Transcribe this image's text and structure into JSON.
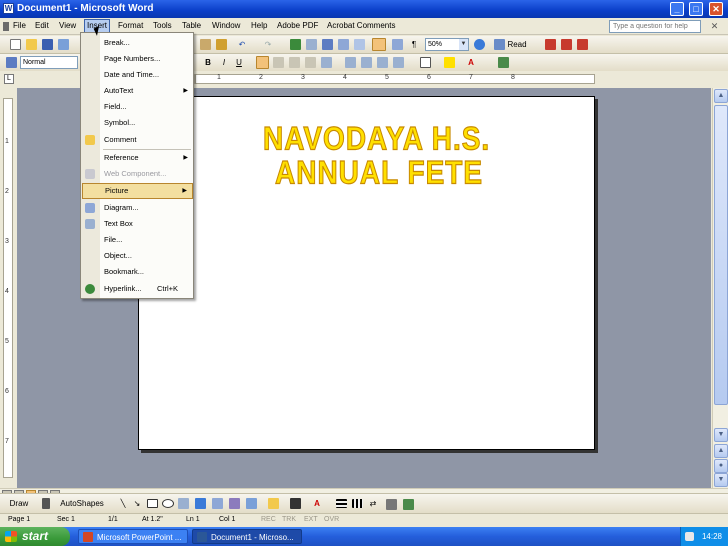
{
  "window": {
    "title": "Document1 - Microsoft Word",
    "minimize_glyph": "_",
    "maximize_glyph": "□",
    "close_glyph": "✕",
    "doc_close_glyph": "✕"
  },
  "menubar": {
    "items": [
      "File",
      "Edit",
      "View",
      "Insert",
      "Format",
      "Tools",
      "Table",
      "Window",
      "Help",
      "Adobe PDF",
      "Acrobat Comments"
    ],
    "active": "Insert",
    "help_placeholder": "Type a question for help"
  },
  "standard_toolbar": {
    "zoom_value": "50%",
    "read_label": "Read"
  },
  "formatting_toolbar": {
    "style_value": "Normal",
    "bold": "B",
    "italic": "I",
    "underline": "U"
  },
  "ruler": {
    "numbers": [
      "1",
      "2",
      "3",
      "4",
      "5",
      "6",
      "7",
      "8"
    ],
    "vertical_numbers": [
      "1",
      "2",
      "3",
      "4",
      "5",
      "6",
      "7"
    ]
  },
  "document": {
    "wordart_line1": "NAVODAYA H.S.",
    "wordart_line2": "ANNUAL FETE"
  },
  "insert_menu": {
    "items": [
      {
        "label": "Break..."
      },
      {
        "label": "Page Numbers..."
      },
      {
        "label": "Date and Time..."
      },
      {
        "label": "AutoText",
        "submenu": "▶"
      },
      {
        "label": "Field..."
      },
      {
        "label": "Symbol..."
      },
      {
        "label": "Comment"
      },
      {
        "label": "Reference",
        "submenu": "▶"
      },
      {
        "label": "Web Component..."
      },
      {
        "label": "Picture",
        "submenu": "▶"
      },
      {
        "label": "Diagram..."
      },
      {
        "label": "Text Box"
      },
      {
        "label": "File..."
      },
      {
        "label": "Object..."
      },
      {
        "label": "Bookmark..."
      },
      {
        "label": "Hyperlink...",
        "shortcut": "Ctrl+K"
      }
    ],
    "selected": "Picture",
    "disabled": "Web Component..."
  },
  "drawing_toolbar": {
    "draw_label": "Draw",
    "autoshapes_label": "AutoShapes"
  },
  "statusbar": {
    "page": "Page 1",
    "sec": "Sec 1",
    "pages": "1/1",
    "at": "At 1.2\"",
    "ln": "Ln 1",
    "col": "Col 1",
    "rec": "REC",
    "trk": "TRK",
    "ext": "EXT",
    "ovr": "OVR"
  },
  "taskbar": {
    "start_label": "start",
    "tasks": [
      "Microsoft PowerPoint ...",
      "Document1 - Microso..."
    ],
    "clock": "14:28"
  },
  "colors": {
    "titlebar_blue": "#0a3ec8",
    "workspace_gray": "#8f96a6",
    "wordart_yellow": "#ffe000",
    "menu_highlight": "#f3dfa0",
    "taskbar_blue": "#245edb",
    "start_green": "#3a9a3a"
  }
}
